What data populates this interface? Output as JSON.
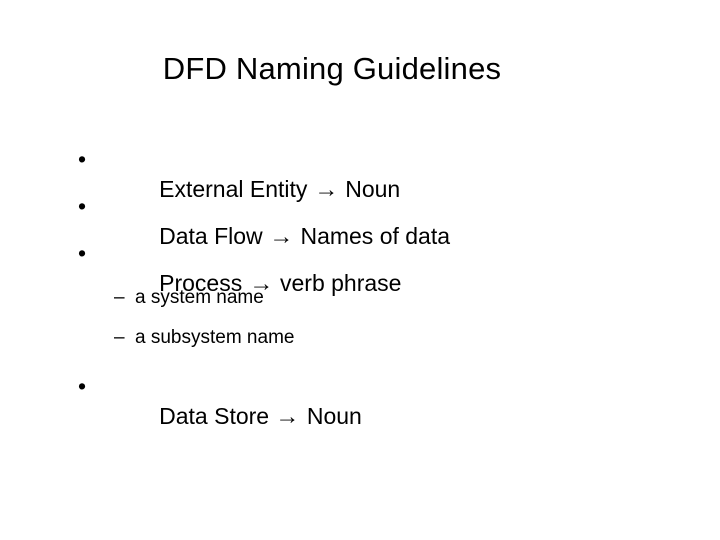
{
  "slide": {
    "title": "DFD Naming Guidelines",
    "background_color": "#ffffff",
    "text_color": "#000000",
    "arrow_symbol": "→",
    "bullet_symbol": "•",
    "sub_bullet_symbol": "–",
    "items": [
      {
        "level": 1,
        "marker": "•",
        "term": "External Entity ",
        "arrow": "→",
        "definition": " Noun",
        "full_text": "External Entity  → Noun"
      },
      {
        "level": 1,
        "marker": "•",
        "term": "Data Flow ",
        "arrow": "→",
        "definition": " Names of data",
        "full_text": "Data Flow  → Names of data"
      },
      {
        "level": 1,
        "marker": "•",
        "term": "Process ",
        "arrow": "→",
        "definition": " verb phrase",
        "full_text": "Process → verb phrase"
      },
      {
        "level": 2,
        "marker": "–",
        "full_text": "a system name"
      },
      {
        "level": 2,
        "marker": "–",
        "full_text": "a subsystem name"
      },
      {
        "level": 1,
        "marker": "•",
        "term": "Data Store ",
        "arrow": "→",
        "definition": " Noun",
        "full_text": "Data Store  → Noun"
      }
    ]
  }
}
